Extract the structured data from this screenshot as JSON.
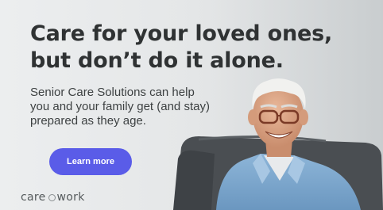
{
  "ad": {
    "headline_line1": "Care for your loved ones,",
    "headline_line2": "but don’t do it alone.",
    "body_line1": "Senior Care Solutions can help",
    "body_line2": "you and your family get (and stay)",
    "body_line3": "prepared as they age.",
    "cta_label": "Learn more",
    "logo_left": "care",
    "logo_right": "work"
  },
  "colors": {
    "background": "#e6e8e9",
    "headline": "#2f3233",
    "cta": "#5a5ce8",
    "cta_text": "#ffffff",
    "shirt": "#7ea9cf",
    "sofa": "#4a4e52"
  },
  "icons": {
    "logo_mark": "circle-dot-icon"
  }
}
